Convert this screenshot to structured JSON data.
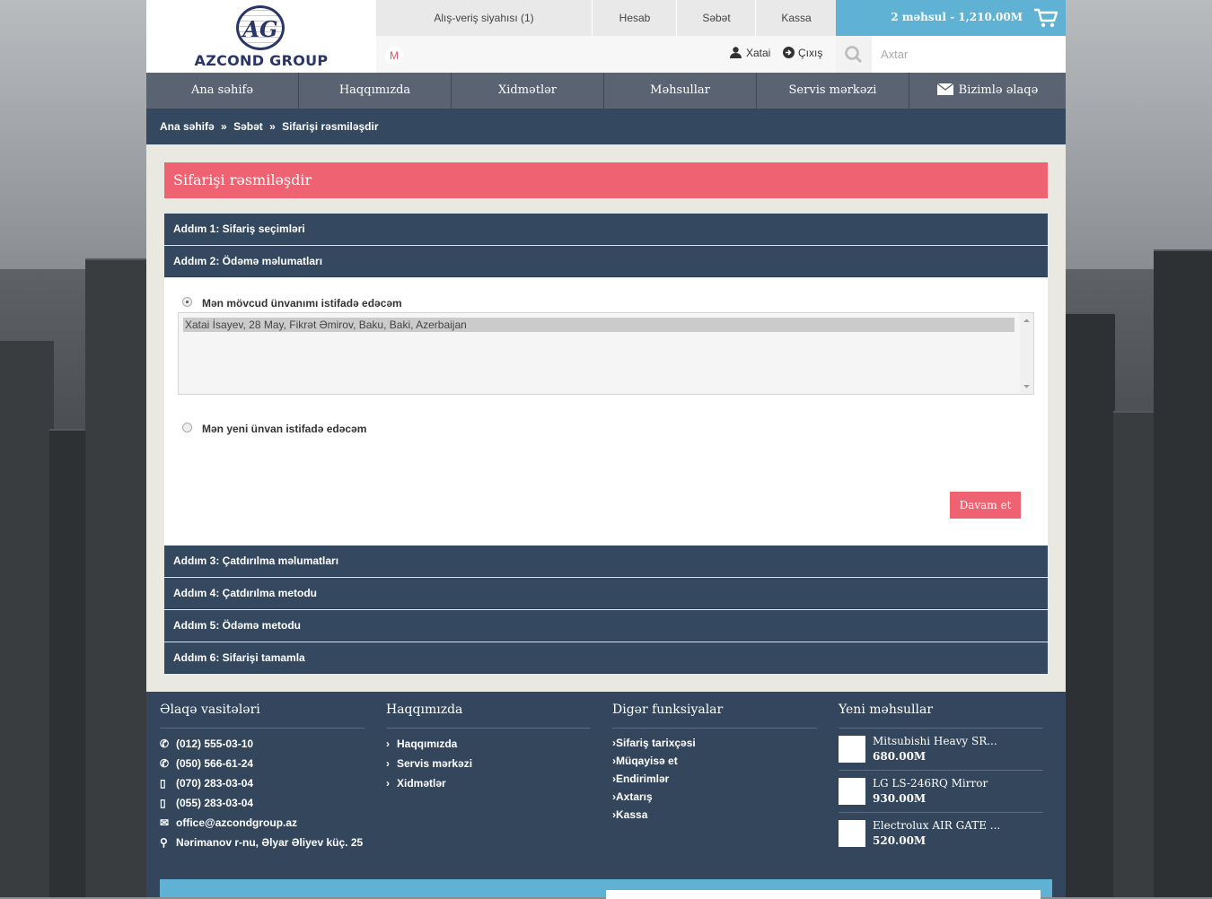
{
  "header": {
    "logo_text": "AZCOND GROUP",
    "logo_mark": "AG",
    "toplinks": [
      "Alış-veriş siyahısı (1)",
      "Hesab",
      "Səbət",
      "Kassa"
    ],
    "cart_summary": "2 məhsul - 1,210.00M",
    "currency": "M",
    "user_name": "Xatai",
    "logout": "Çıxış",
    "search_placeholder": "Axtar"
  },
  "nav": [
    "Ana səhifə",
    "Haqqımızda",
    "Xidmətlər",
    "Məhsullar",
    "Servis mərkəzi",
    "Bizimlə əlaqə"
  ],
  "breadcrumb": [
    "Ana səhifə",
    "»",
    "Səbət",
    "»",
    "Sifarişi rəsmiləşdir"
  ],
  "page_title": "Sifarişi rəsmiləşdir",
  "steps_top": [
    "Addım 1: Sifariş seçimləri",
    "Addım 2: Ödəmə məlumatları"
  ],
  "payment": {
    "existing_label": "Mən mövcud ünvanımı istifadə edəcəm",
    "existing_selected": true,
    "address": "Xatai İsayev, 28 May, Fikrət Əmirov, Baku, Baki, Azerbaijan",
    "new_label": "Mən yeni ünvan istifadə edəcəm",
    "continue": "Davam et"
  },
  "steps_bottom": [
    "Addım 3: Çatdırılma məlumatları",
    "Addım 4: Çatdırılma metodu",
    "Addım 5: Ödəmə metodu",
    "Addım 6: Sifarişi tamamla"
  ],
  "footer": {
    "contact_title": "Əlaqə vasitələri",
    "contacts": [
      {
        "icon": "phone-icon",
        "text": "(012) 555-03-10"
      },
      {
        "icon": "phone-icon",
        "text": "(050) 566-61-24"
      },
      {
        "icon": "mobile-icon",
        "text": "(070) 283-03-04"
      },
      {
        "icon": "mobile-icon",
        "text": "(055) 283-03-04"
      },
      {
        "icon": "mail-icon",
        "text": "office@azcondgroup.az"
      },
      {
        "icon": "location-icon",
        "text": "Nərimanov r-nu, Əlyar Əliyev küç. 25"
      }
    ],
    "about_title": "Haqqımızda",
    "about_links": [
      "Haqqımızda",
      "Servis mərkəzi",
      "Xidmətlər"
    ],
    "other_title": "Digər funksiyalar",
    "other_links": [
      "Sifariş tarixçəsi",
      "Müqayisə et",
      "Endirimlər",
      "Axtarış",
      "Kassa"
    ],
    "new_title": "Yeni məhsullar",
    "products": [
      {
        "name": "Mitsubishi Heavy SR...",
        "price": "680.00M"
      },
      {
        "name": "LG LS-246RQ Mirror",
        "price": "930.00M"
      },
      {
        "name": "Electrolux AIR GATE ...",
        "price": "520.00M"
      }
    ]
  },
  "colors": {
    "accent": "#ef6272",
    "navy": "#344860",
    "cart_blue": "#5fb2d3"
  }
}
